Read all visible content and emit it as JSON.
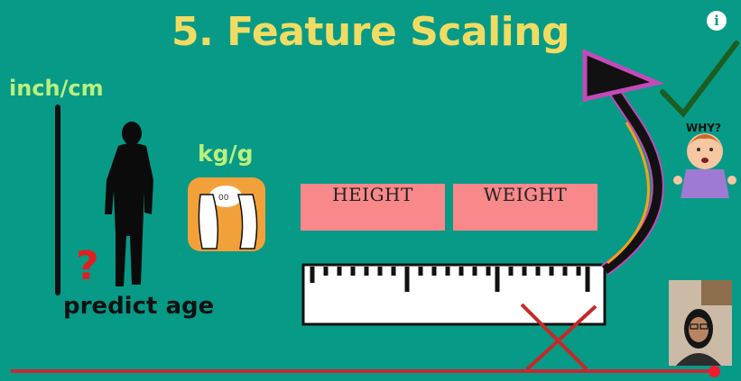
{
  "slide": {
    "title": "5. Feature Scaling",
    "unit_height": "inch/cm",
    "unit_weight": "kg/g",
    "question_mark": "?",
    "predict_label": "predict age",
    "features": [
      "HEIGHT",
      "WEIGHT"
    ],
    "why_label": "WHY?",
    "scale_reading": "00"
  },
  "player": {
    "info_icon_label": "i",
    "progress": 0.97
  },
  "colors": {
    "background": "#079a87",
    "title": "#f0dc62",
    "unit_label": "#b9f07e",
    "feature_box": "#f8888a",
    "progress": "#f01a2e"
  }
}
